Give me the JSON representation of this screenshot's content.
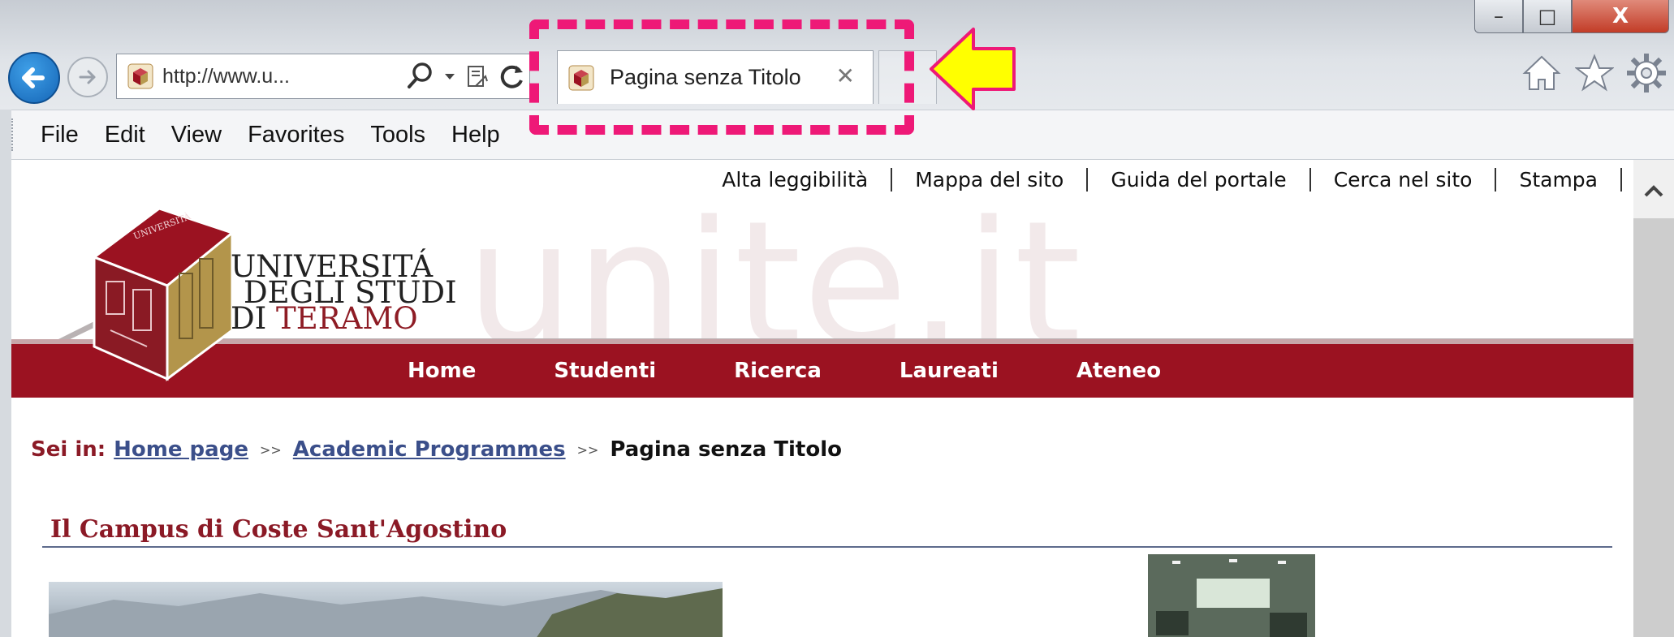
{
  "browser": {
    "address_text": "http://www.u...",
    "tab_title": "Pagina senza Titolo",
    "tab_close_glyph": "✕",
    "menu": [
      "File",
      "Edit",
      "View",
      "Favorites",
      "Tools",
      "Help"
    ],
    "icons": {
      "back": "back-arrow-icon",
      "forward": "forward-arrow-icon",
      "search": "search-icon",
      "dropdown": "chevron-down-icon",
      "compat": "compatibility-view-icon",
      "refresh": "refresh-icon",
      "home": "home-icon",
      "favorites": "star-icon",
      "settings": "gear-icon"
    },
    "window_controls": {
      "minimize": "–",
      "maximize": "□",
      "close": "X"
    }
  },
  "annotation": {
    "box_color": "#ee1977",
    "arrow_color": "#ffff00"
  },
  "site": {
    "utility_links": [
      "Alta leggibilità",
      "Mappa del sito",
      "Guida del portale",
      "Cerca nel sito",
      "Stampa"
    ],
    "watermark": "unite.it",
    "logo": {
      "line1": "UNIVERSITÁ",
      "line2": "DEGLI STUDI",
      "line3a": "DI ",
      "line3b": "TERAMO"
    },
    "nav": [
      "Home",
      "Studenti",
      "Ricerca",
      "Laureati",
      "Ateneo"
    ],
    "breadcrumb": {
      "prefix": "Sei in:",
      "links": [
        "Home page",
        "Academic Programmes "
      ],
      "separator": ">>",
      "current": "Pagina senza Titolo"
    },
    "section_title": "Il Campus di Coste Sant'Agostino",
    "colors": {
      "brand": "#9b1221",
      "title": "#8b1a26",
      "link": "#3b4f8a"
    }
  }
}
